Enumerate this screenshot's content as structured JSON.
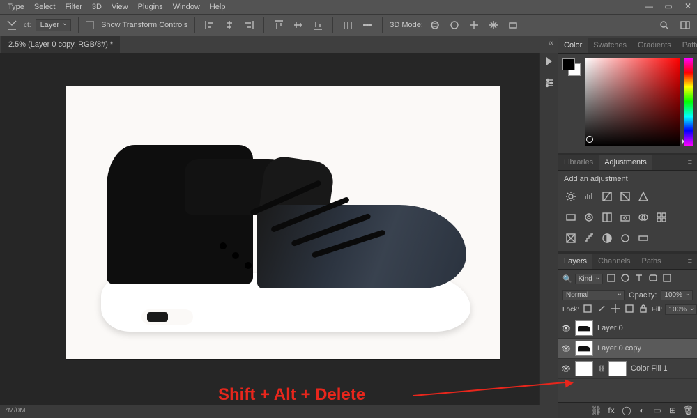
{
  "menu": {
    "items": [
      "Type",
      "Select",
      "Filter",
      "3D",
      "View",
      "Plugins",
      "Window",
      "Help"
    ]
  },
  "options_bar": {
    "layer_label": "Layer",
    "show_transform": "Show Transform Controls",
    "mode3d_label": "3D Mode:"
  },
  "doc_tab": "2.5% (Layer 0 copy, RGB/8#) *",
  "right_panels": {
    "color_tabs": [
      "Color",
      "Swatches",
      "Gradients",
      "Patterns"
    ],
    "color_active": "Color",
    "lib_tabs": [
      "Libraries",
      "Adjustments"
    ],
    "lib_active": "Adjustments",
    "add_adjustment": "Add an adjustment"
  },
  "layers_panel": {
    "tabs": [
      "Layers",
      "Channels",
      "Paths"
    ],
    "active": "Layers",
    "kind_icon": "🔍",
    "kind_label": "Kind",
    "blend_mode": "Normal",
    "opacity_label": "Opacity:",
    "opacity_value": "100%",
    "lock_label": "Lock:",
    "fill_label": "Fill:",
    "fill_value": "100%",
    "layers": [
      {
        "name": "Layer 0",
        "visible": true,
        "thumb": "shoe"
      },
      {
        "name": "Layer 0 copy",
        "visible": true,
        "thumb": "shoe",
        "selected": true
      },
      {
        "name": "Color Fill 1",
        "visible": true,
        "thumb": "mask",
        "locked": true
      }
    ]
  },
  "annotation": "Shift + Alt + Delete",
  "status": "7M/0M"
}
